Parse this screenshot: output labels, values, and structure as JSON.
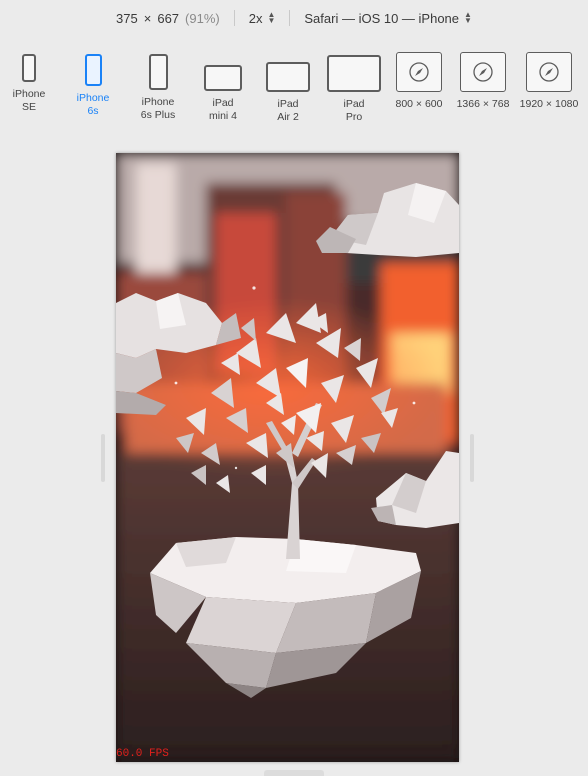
{
  "toolbar": {
    "width": "375",
    "times": "×",
    "height": "667",
    "scale_pct": "(91%)",
    "pixel_ratio": "2x",
    "user_agent": "Safari — iOS 10 — iPhone"
  },
  "devices": [
    {
      "label": "iPhone\nSE",
      "icon": "phone-icon",
      "active": false
    },
    {
      "label": "iPhone\n6s",
      "icon": "phone-icon",
      "active": true
    },
    {
      "label": "iPhone\n6s Plus",
      "icon": "phone-icon",
      "active": false
    },
    {
      "label": "iPad\nmini 4",
      "icon": "tablet-icon",
      "active": false
    },
    {
      "label": "iPad\nAir 2",
      "icon": "tablet-icon",
      "active": false
    },
    {
      "label": "iPad\nPro",
      "icon": "tablet-icon",
      "active": false
    },
    {
      "label": "800 × 600",
      "icon": "compass-icon",
      "active": false
    },
    {
      "label": "1366 × 768",
      "icon": "compass-icon",
      "active": false
    },
    {
      "label": "1920 × 1080",
      "icon": "compass-icon",
      "active": false
    }
  ],
  "viewport": {
    "fps": "60.0 FPS"
  },
  "colors": {
    "accent": "#1a82f7",
    "fps": "#e0211c"
  }
}
